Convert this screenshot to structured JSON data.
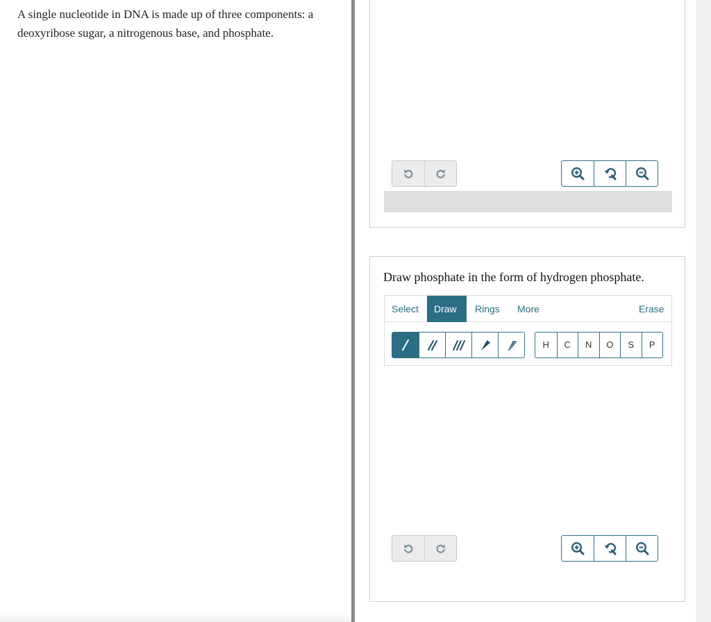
{
  "question": {
    "intro_text": "A single nucleotide in DNA is made up of three components: a deoxyribose sugar, a nitrogenous base, and phosphate."
  },
  "top_panel": {
    "history_icons": [
      "undo-icon",
      "redo-icon"
    ],
    "zoom_icons": [
      "zoom-in-icon",
      "zoom-reset-icon",
      "zoom-out-icon"
    ]
  },
  "bottom_panel": {
    "prompt": "Draw phosphate in the form of hydrogen phosphate.",
    "tabs": {
      "select": "Select",
      "draw": "Draw",
      "rings": "Rings",
      "more": "More",
      "erase": "Erase",
      "active": "Draw"
    },
    "bond_tools": [
      "single-bond-icon",
      "double-bond-icon",
      "triple-bond-icon",
      "wedge-bond-icon",
      "hash-bond-icon"
    ],
    "atoms": [
      "H",
      "C",
      "N",
      "O",
      "S",
      "P"
    ],
    "history_icons": [
      "undo-icon",
      "redo-icon"
    ],
    "zoom_icons": [
      "zoom-in-icon",
      "zoom-reset-icon",
      "zoom-out-icon"
    ]
  },
  "colors": {
    "accent": "#2b6d83",
    "panel_border": "#cfcfcf",
    "disabled_button": "#ececec",
    "canvas_gray": "#dedede"
  }
}
